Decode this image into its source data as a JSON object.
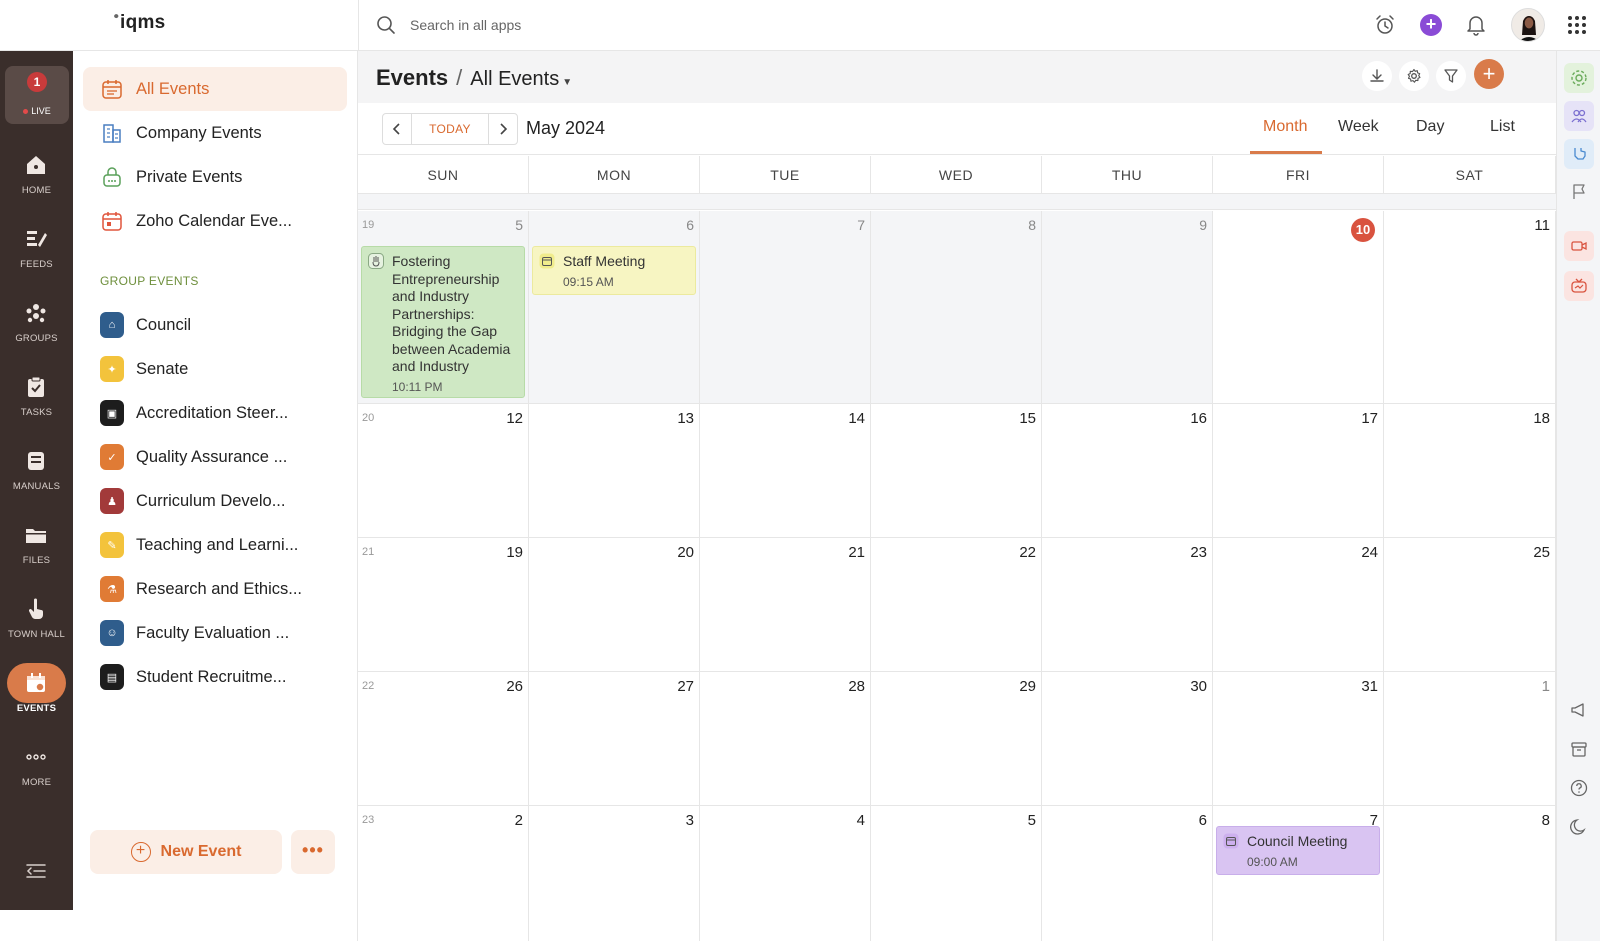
{
  "app": {
    "logo": "iqms",
    "logo_mark": "⦁"
  },
  "search": {
    "placeholder": "Search in all apps"
  },
  "rail": {
    "live": {
      "count": "1",
      "label": "LIVE"
    },
    "items": [
      {
        "label": "HOME",
        "icon": "home-icon"
      },
      {
        "label": "FEEDS",
        "icon": "feeds-icon"
      },
      {
        "label": "GROUPS",
        "icon": "groups-icon"
      },
      {
        "label": "TASKS",
        "icon": "tasks-icon"
      },
      {
        "label": "MANUALS",
        "icon": "manuals-icon"
      },
      {
        "label": "FILES",
        "icon": "files-icon"
      },
      {
        "label": "TOWN HALL",
        "icon": "town-hall-icon"
      },
      {
        "label": "EVENTS",
        "icon": "events-icon"
      },
      {
        "label": "MORE",
        "icon": "more-icon"
      }
    ]
  },
  "sidebar": {
    "items": [
      {
        "label": "All Events",
        "icon": "calendar-icon"
      },
      {
        "label": "Company Events",
        "icon": "building-icon"
      },
      {
        "label": "Private Events",
        "icon": "lock-calendar-icon"
      },
      {
        "label": "Zoho Calendar Eve...",
        "icon": "zoho-calendar-icon"
      }
    ],
    "group_heading": "GROUP EVENTS",
    "groups": [
      {
        "label": "Council",
        "color": "#2f5d8c"
      },
      {
        "label": "Senate",
        "color": "#f3c33c"
      },
      {
        "label": "Accreditation Steer...",
        "color": "#1d1d1d"
      },
      {
        "label": "Quality Assurance ...",
        "color": "#e07b35"
      },
      {
        "label": "Curriculum Develo...",
        "color": "#a23a3a"
      },
      {
        "label": "Teaching and Learni...",
        "color": "#f3c33c"
      },
      {
        "label": "Research and Ethics...",
        "color": "#e07b35"
      },
      {
        "label": "Faculty Evaluation ...",
        "color": "#2f5d8c"
      },
      {
        "label": "Student Recruitme...",
        "color": "#1d1d1d"
      }
    ],
    "new_event": "New Event",
    "more": "•••"
  },
  "main": {
    "breadcrumb_root": "Events",
    "breadcrumb_sep": "/",
    "breadcrumb_current": "All Events",
    "today": "TODAY",
    "month_title": "May 2024",
    "views": [
      "Month",
      "Week",
      "Day",
      "List"
    ],
    "active_view": "Month"
  },
  "calendar": {
    "days_of_week": [
      "SUN",
      "MON",
      "TUE",
      "WED",
      "THU",
      "FRI",
      "SAT"
    ],
    "weeks": [
      {
        "week": "19",
        "days": [
          "5",
          "6",
          "7",
          "8",
          "9",
          "10",
          "11"
        ]
      },
      {
        "week": "20",
        "days": [
          "12",
          "13",
          "14",
          "15",
          "16",
          "17",
          "18"
        ]
      },
      {
        "week": "21",
        "days": [
          "19",
          "20",
          "21",
          "22",
          "23",
          "24",
          "25"
        ]
      },
      {
        "week": "22",
        "days": [
          "26",
          "27",
          "28",
          "29",
          "30",
          "31",
          "1"
        ]
      },
      {
        "week": "23",
        "days": [
          "2",
          "3",
          "4",
          "5",
          "6",
          "7",
          "8"
        ]
      }
    ],
    "today": "10",
    "events": [
      {
        "title": "Fostering Entrepreneurship and Industry Partnerships: Bridging the Gap between Academia and Industry",
        "time": "10:11 PM",
        "color": "#cfe8c4"
      },
      {
        "title": "Staff Meeting",
        "time": "09:15 AM",
        "color": "#f7f5c2"
      },
      {
        "title": "Council Meeting",
        "time": "09:00 AM",
        "color": "#d9c4f2"
      }
    ]
  },
  "colors": {
    "accent": "#d97b4a",
    "rail_bg": "#3a2e2b",
    "today": "#d9533f"
  }
}
